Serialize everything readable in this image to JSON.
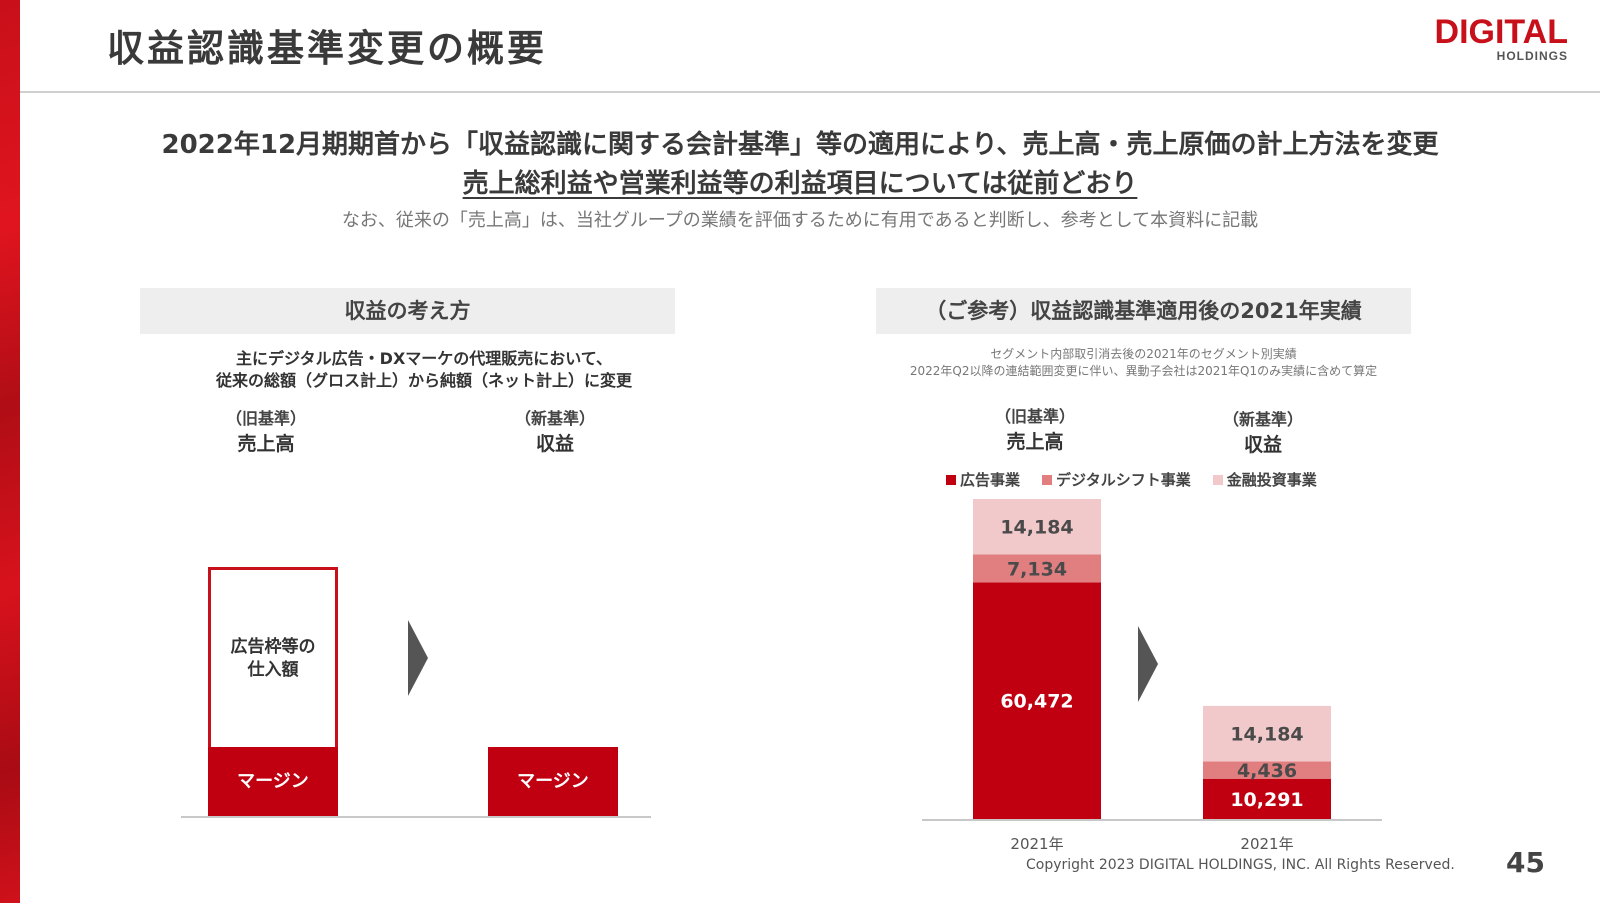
{
  "header": {
    "title": "収益認識基準変更の概要",
    "logo_main": "DIGITAL",
    "logo_sub": "HOLDINGS"
  },
  "headline": {
    "line1": "2022年12月期期首から「収益認識に関する会計基準」等の適用により、売上高・売上原価の計上方法を変更",
    "line2": "売上総利益や営業利益等の利益項目については従前どおり",
    "line3": "なお、従来の「売上高」は、当社グループの業績を評価するために有用であると判断し、参考として本資料に記載"
  },
  "left_panel": {
    "title": "収益の考え方",
    "desc_line1": "主にデジタル広告・DXマーケの代理販売において、",
    "desc_line2": "従来の総額（グロス計上）から純額（ネット計上）に変更",
    "old_sub": "（旧基準）",
    "old_main": "売上高",
    "new_sub": "（新基準）",
    "new_main": "収益",
    "cost_line1": "広告枠等の",
    "cost_line2": "仕入額",
    "margin_label": "マージン"
  },
  "right_panel": {
    "title": "（ご参考）収益認識基準適用後の2021年実績",
    "note_line1": "セグメント内部取引消去後の2021年のセグメント別実績",
    "note_line2": "2022年Q2以降の連結範囲変更に伴い、異動子会社は2021年Q1のみ実績に含めて算定",
    "old_sub": "（旧基準）",
    "old_main": "売上高",
    "new_sub": "（新基準）",
    "new_main": "収益"
  },
  "chart_data": {
    "type": "bar",
    "stacked": true,
    "categories": [
      "2021年",
      "2021年"
    ],
    "series": [
      {
        "name": "広告事業",
        "values": [
          60472,
          10291
        ],
        "labels": [
          "60,472",
          "10,291"
        ],
        "color": "#c00010"
      },
      {
        "name": "デジタルシフト事業",
        "values": [
          7134,
          4436
        ],
        "labels": [
          "7,134",
          "4,436"
        ],
        "color": "#e07e80"
      },
      {
        "name": "金融投資事業",
        "values": [
          14184,
          14184
        ],
        "labels": [
          "14,184",
          "14,184"
        ],
        "color": "#f2c9ca"
      }
    ],
    "legend_position": "top",
    "grid": false
  },
  "colors": {
    "accent": "#c8101a",
    "bar_red": "#c00010",
    "bar_mid": "#e07e80",
    "bar_light": "#f2c9ca",
    "arrow": "#555555"
  },
  "footer": {
    "copyright": "Copyright 2023 DIGITAL HOLDINGS, INC. All Rights Reserved.",
    "page": "45"
  }
}
